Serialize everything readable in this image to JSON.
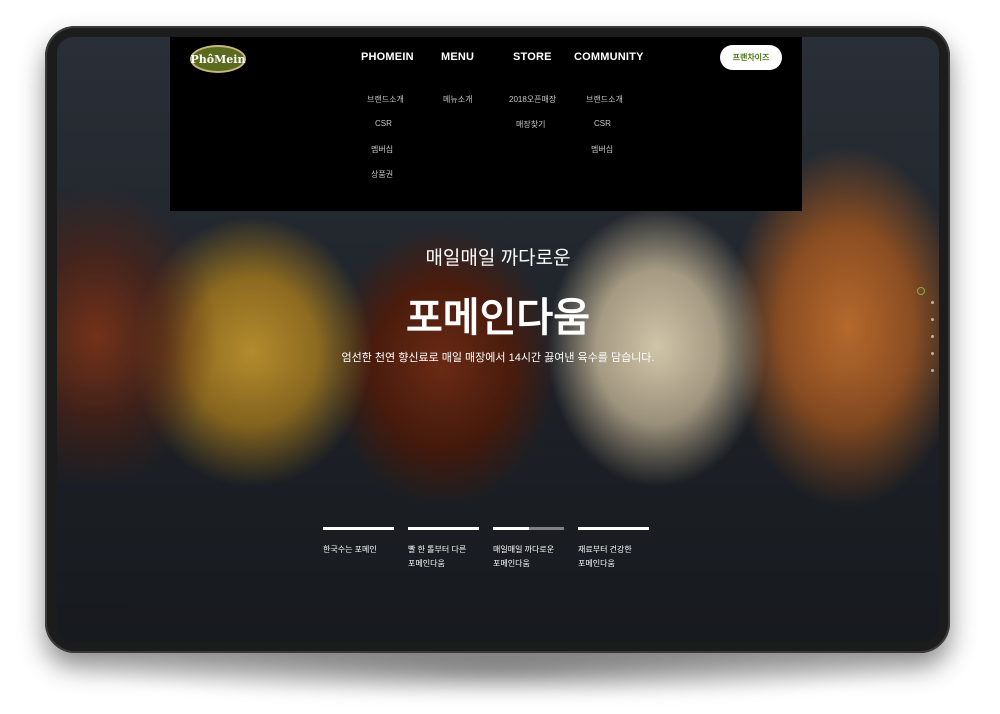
{
  "logo": {
    "text": "PhôMein"
  },
  "nav": {
    "items": [
      "PHOMEIN",
      "MENU",
      "STORE",
      "COMMUNITY"
    ],
    "franchise_label": "프랜차이즈"
  },
  "submenu": {
    "phomein": [
      "브랜드소개",
      "CSR",
      "멤버십",
      "상품권"
    ],
    "menu": [
      "메뉴소개"
    ],
    "store": [
      "2018오픈매장",
      "매장찾기"
    ],
    "community": [
      "브랜드소개",
      "CSR",
      "멤버십"
    ]
  },
  "hero": {
    "subtitle": "매일매일 까다로운",
    "title": "포메인다움",
    "description": "엄선한 천연 향신료로 매일 매장에서 14시간 끓여낸 육수를 담습니다."
  },
  "slides": [
    {
      "label": "한국수는 포메인",
      "progress": 1.0
    },
    {
      "label": "빨 한 톨부터 다른\n포메인다움",
      "progress": 1.0
    },
    {
      "label": "매일매일 까다로운\n포메인다움",
      "progress": 0.5
    },
    {
      "label": "재료부터 건강한\n포메인다움",
      "progress": 1.0
    }
  ],
  "colors": {
    "accent_green": "#4a7a1a",
    "nav_bg": "#000000"
  }
}
